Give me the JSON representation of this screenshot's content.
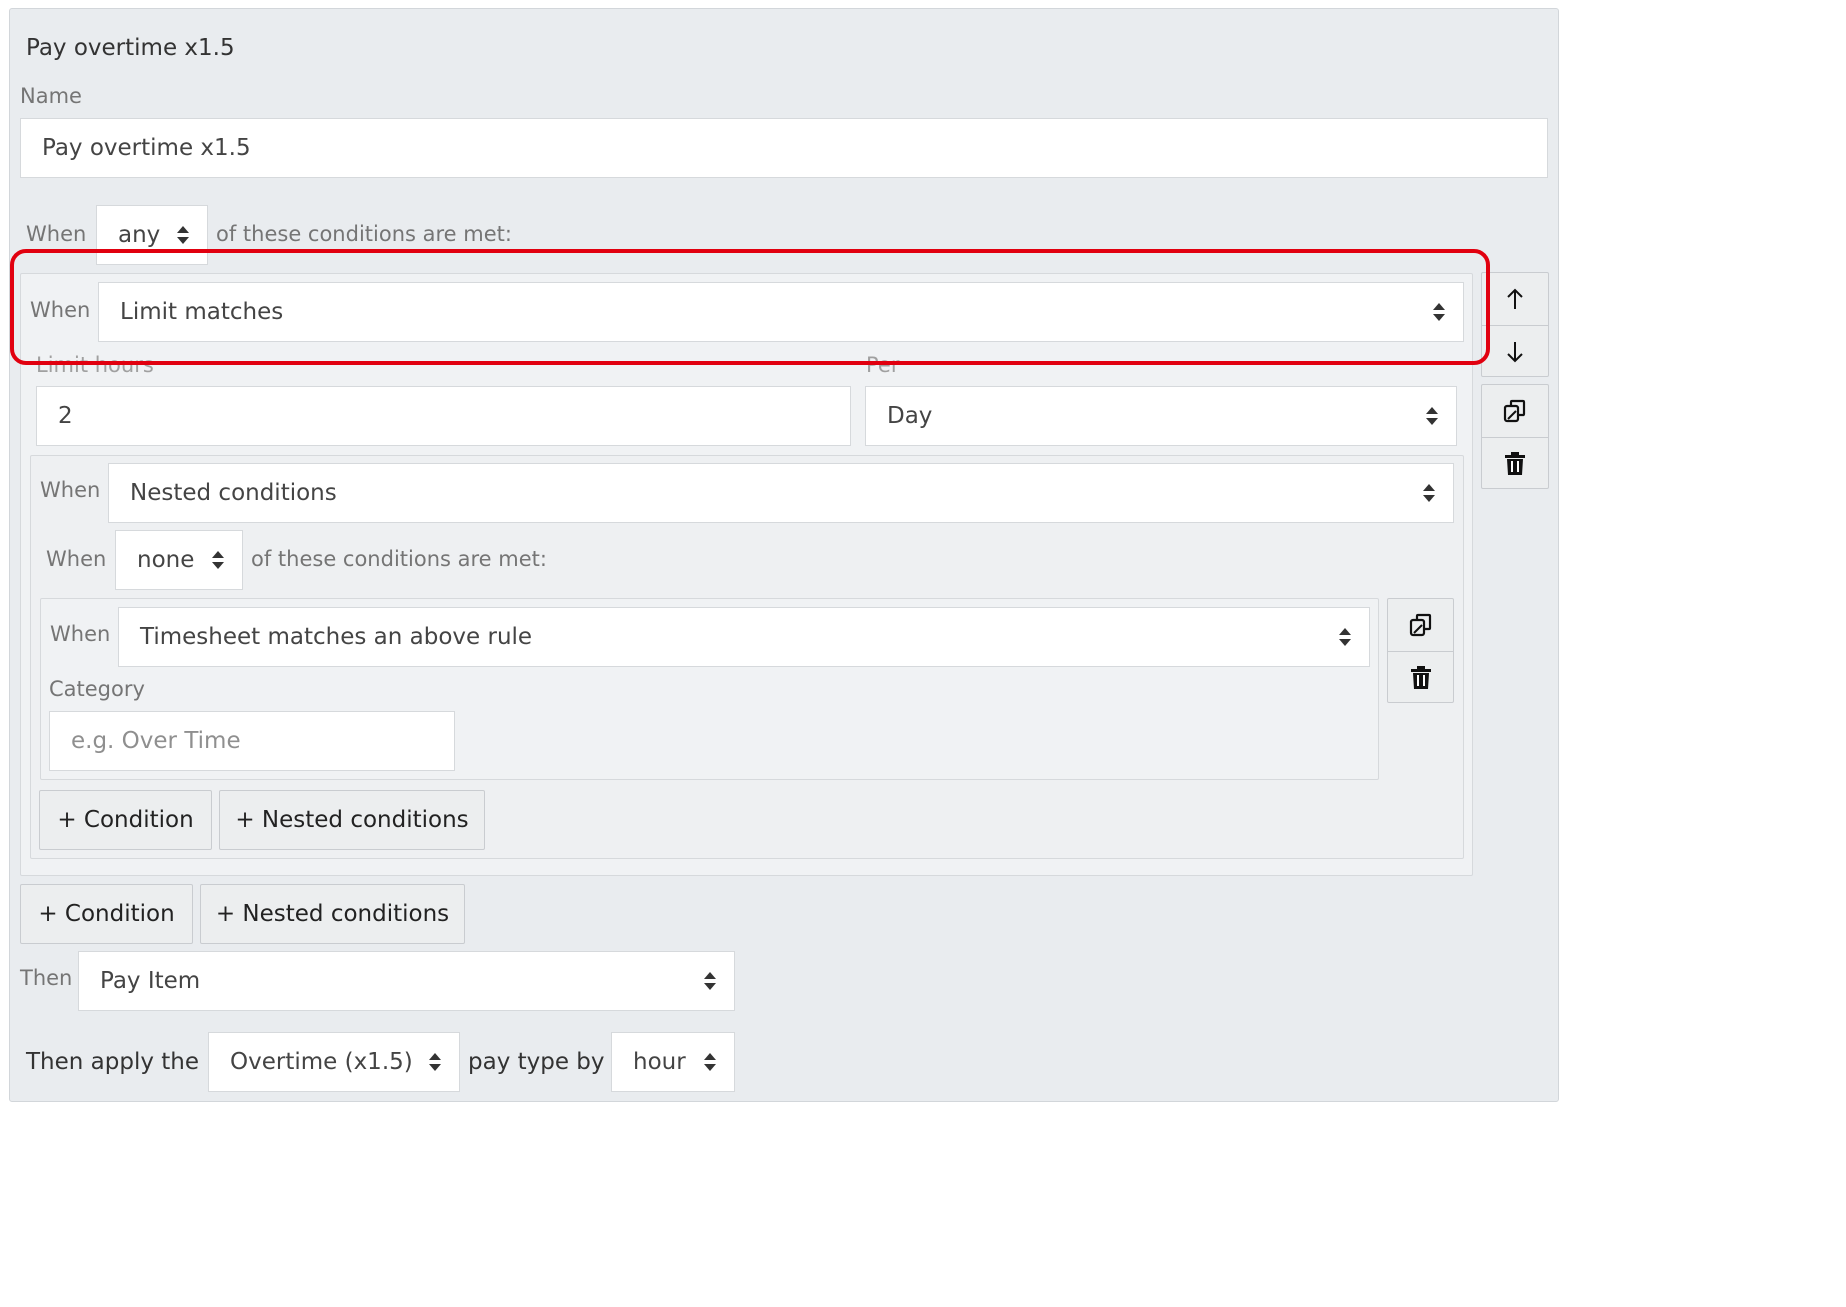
{
  "rule": {
    "title": "Pay overtime x1.5",
    "name_label": "Name",
    "name_value": "Pay overtime x1.5",
    "when_label": "When",
    "match_mode": "any",
    "conditions_suffix": "of these conditions are met:"
  },
  "condition1": {
    "when_label": "When",
    "type": "Limit matches",
    "limit_hours_label": "Limit hours",
    "limit_hours_value": "2",
    "per_label": "Per",
    "per_value": "Day"
  },
  "nested": {
    "when_label": "When",
    "type": "Nested conditions",
    "inner_when_label": "When",
    "match_mode": "none",
    "conditions_suffix": "of these conditions are met:",
    "inner_condition": {
      "when_label": "When",
      "type": "Timesheet matches an above rule",
      "category_label": "Category",
      "category_placeholder": "e.g. Over Time"
    },
    "add_condition": "+ Condition",
    "add_nested": "+ Nested conditions"
  },
  "outer_buttons": {
    "add_condition": "+ Condition",
    "add_nested": "+ Nested conditions"
  },
  "then": {
    "label": "Then",
    "value": "Pay Item",
    "apply_prefix": "Then apply the",
    "pay_type": "Overtime (x1.5)",
    "by_label": "pay type by",
    "unit": "hour"
  },
  "icons": {
    "move_up": "arrow-up-icon",
    "move_down": "arrow-down-icon",
    "duplicate": "copy-icon",
    "delete": "trash-icon"
  },
  "colors": {
    "panel_bg": "#e9ecef",
    "highlight": "#e1000f"
  }
}
